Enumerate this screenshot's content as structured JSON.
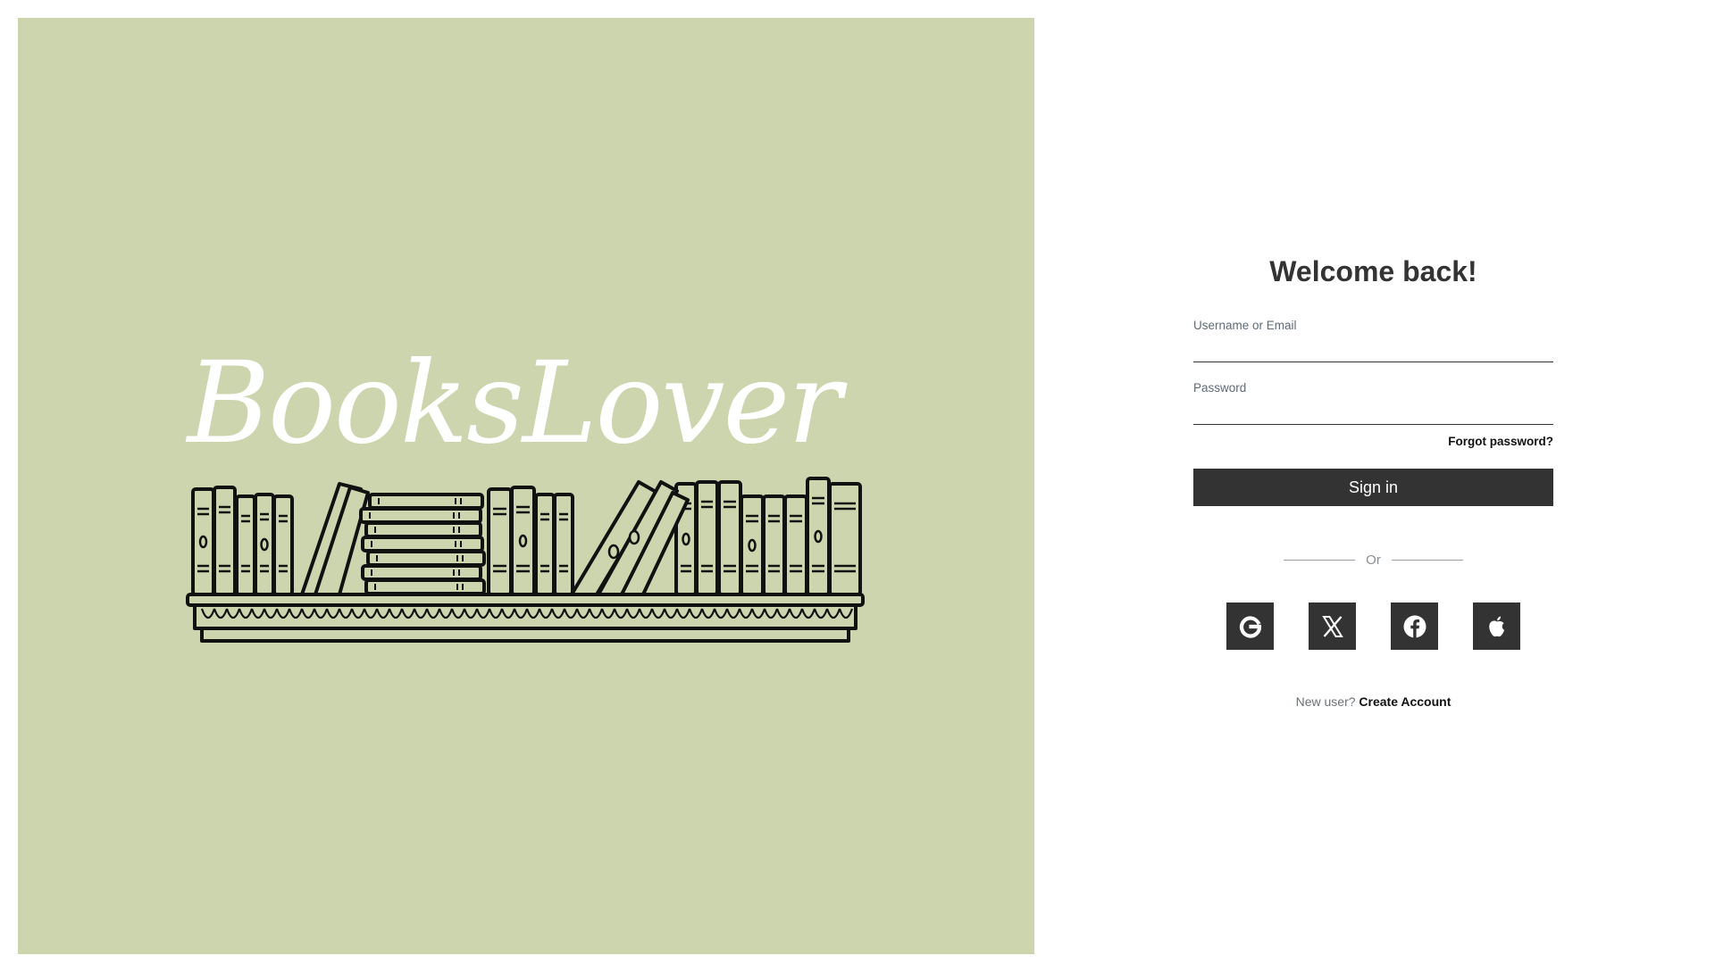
{
  "hero": {
    "brand": "BooksLover",
    "logo_icon": "bookshelf-illustration",
    "background_color": "#cdd5ae"
  },
  "login": {
    "title": "Welcome back!",
    "username_label": "Username or Email",
    "username_value": "",
    "password_label": "Password",
    "password_value": "",
    "forgot_label": "Forgot password?",
    "signin_label": "Sign in",
    "divider_text": "Or",
    "socials": [
      {
        "name": "Google",
        "icon": "google-icon"
      },
      {
        "name": "X",
        "icon": "x-icon"
      },
      {
        "name": "Facebook",
        "icon": "facebook-icon"
      },
      {
        "name": "Apple",
        "icon": "apple-icon"
      }
    ],
    "signup_prompt": "New user?",
    "signup_link": "Create Account",
    "accent_color": "#333333"
  }
}
